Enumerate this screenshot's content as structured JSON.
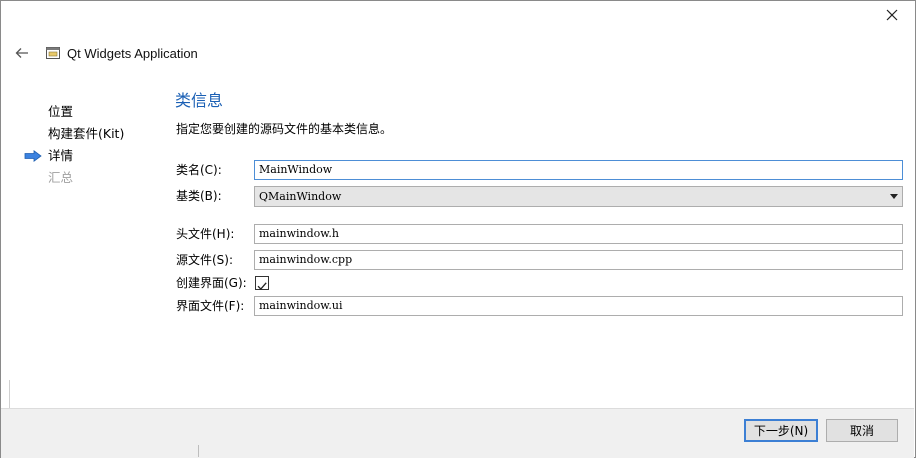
{
  "window": {
    "app_title": "Qt Widgets Application"
  },
  "icons": {
    "close": "close-icon",
    "back": "back-arrow-icon",
    "app": "app-window-icon",
    "current_step": "current-step-arrow-icon",
    "check": "checkmark-icon"
  },
  "steps": [
    {
      "label": "位置",
      "state": "done"
    },
    {
      "label": "构建套件(Kit)",
      "state": "done"
    },
    {
      "label": "详情",
      "state": "current"
    },
    {
      "label": "汇总",
      "state": "pending"
    }
  ],
  "page": {
    "title": "类信息",
    "description": "指定您要创建的源码文件的基本类信息。"
  },
  "form": {
    "class_name": {
      "label": "类名(C):",
      "value": "MainWindow"
    },
    "base_class": {
      "label": "基类(B):",
      "value": "QMainWindow"
    },
    "header_file": {
      "label": "头文件(H):",
      "value": "mainwindow.h"
    },
    "source_file": {
      "label": "源文件(S):",
      "value": "mainwindow.cpp"
    },
    "generate_form": {
      "label": "创建界面(G):",
      "checked": true
    },
    "form_file": {
      "label": "界面文件(F):",
      "value": "mainwindow.ui"
    }
  },
  "buttons": {
    "next": "下一步(N)",
    "cancel": "取消"
  },
  "colors": {
    "title_blue": "#1a5fb4",
    "arrow_blue": "#3b82e0",
    "focus_border": "#4d8ed6",
    "default_button_border": "#3c7fd4"
  }
}
